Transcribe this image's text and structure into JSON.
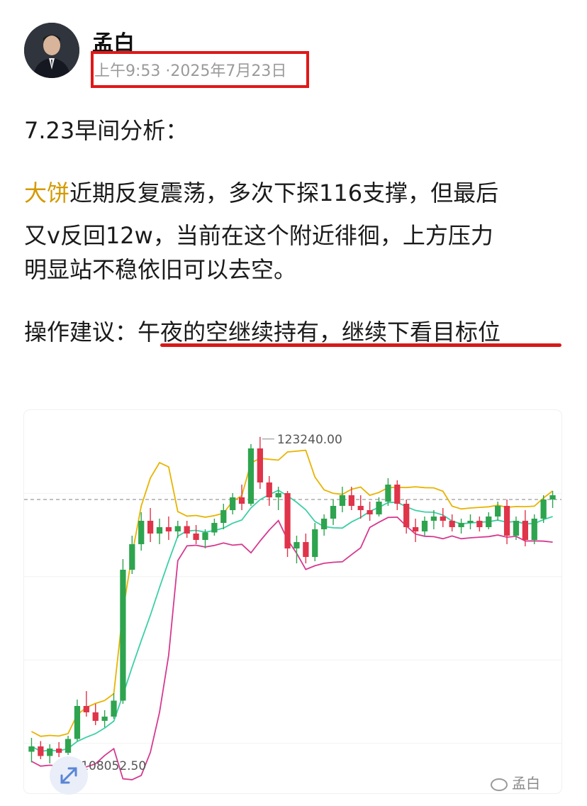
{
  "post": {
    "author": "孟白",
    "time": "上午9:53 ·2025年7月23日",
    "heading": "7.23早间分析：",
    "para_highlight": "大饼",
    "para_line1": "近期反复震荡，多次下探116支撑，但最后",
    "para_line2": "又v反回12w，当前在这个附近徘徊，上方压力",
    "para_line3": "明显站不稳依旧可以去空。",
    "advice_label": "操作建议：",
    "advice_text": "午夜的空继续持有，继续下看目标位"
  },
  "watermark": "孟白",
  "colors": {
    "highlight": "#d49a00",
    "timestamp_box": "#e01818",
    "underline": "#d71a1a",
    "candle_up": "#2ea44f",
    "candle_down": "#e0344a",
    "band_upper": "#e8b400",
    "band_middle": "#3ccfa6",
    "band_lower": "#d6398f"
  },
  "chart_data": {
    "type": "candlestick",
    "title": "",
    "price_labels": {
      "high": "123240.00",
      "low": "108052.50"
    },
    "ylim": [
      106500,
      124500
    ],
    "current_price_line": 120300,
    "bands": [
      "upper",
      "middle",
      "lower"
    ],
    "candles_ohlc": [
      [
        108450,
        109100,
        107950,
        108700
      ],
      [
        108700,
        108950,
        108100,
        108250
      ],
      [
        108250,
        108800,
        107900,
        108600
      ],
      [
        108600,
        108900,
        108200,
        108400
      ],
      [
        108400,
        109200,
        108300,
        109050
      ],
      [
        109050,
        110900,
        108950,
        110600
      ],
      [
        110600,
        111300,
        110100,
        110300
      ],
      [
        110300,
        110700,
        109700,
        109900
      ],
      [
        109900,
        110400,
        109600,
        110100
      ],
      [
        110100,
        111200,
        110000,
        110850
      ],
      [
        110850,
        117500,
        110700,
        117000
      ],
      [
        117000,
        118600,
        116800,
        118200
      ],
      [
        118200,
        119700,
        117900,
        119300
      ],
      [
        119300,
        119900,
        118300,
        118700
      ],
      [
        118700,
        119400,
        118200,
        119000
      ],
      [
        119000,
        119500,
        118400,
        118800
      ],
      [
        118800,
        119300,
        118500,
        119050
      ],
      [
        119050,
        119300,
        118500,
        118700
      ],
      [
        118700,
        119100,
        118200,
        118400
      ],
      [
        118400,
        118900,
        118000,
        118750
      ],
      [
        118750,
        119400,
        118600,
        119200
      ],
      [
        119200,
        120100,
        118900,
        119800
      ],
      [
        119800,
        120600,
        119600,
        120400
      ],
      [
        120400,
        121000,
        119800,
        120100
      ],
      [
        120100,
        122900,
        120000,
        122700
      ],
      [
        122700,
        123240,
        120800,
        121100
      ],
      [
        121100,
        121400,
        120000,
        120400
      ],
      [
        120400,
        120900,
        119800,
        120600
      ],
      [
        120600,
        120700,
        117600,
        118000
      ],
      [
        118000,
        118600,
        117300,
        118300
      ],
      [
        118300,
        118700,
        117300,
        117600
      ],
      [
        117600,
        119200,
        117400,
        118900
      ],
      [
        118900,
        119600,
        118600,
        119400
      ],
      [
        119400,
        120300,
        119100,
        120000
      ],
      [
        120000,
        120900,
        119700,
        120500
      ],
      [
        120500,
        120900,
        119800,
        120000
      ],
      [
        120000,
        120500,
        119400,
        119800
      ],
      [
        119800,
        120200,
        119300,
        119600
      ],
      [
        119600,
        120400,
        119500,
        120200
      ],
      [
        120200,
        121300,
        120000,
        121000
      ],
      [
        121000,
        121200,
        119800,
        120100
      ],
      [
        120100,
        120300,
        118700,
        119000
      ],
      [
        119000,
        119400,
        118300,
        118800
      ],
      [
        118800,
        119500,
        118600,
        119300
      ],
      [
        119300,
        119800,
        118900,
        119500
      ],
      [
        119500,
        119900,
        119000,
        119300
      ],
      [
        119300,
        119600,
        118800,
        119000
      ],
      [
        119000,
        119400,
        118700,
        119200
      ],
      [
        119200,
        119600,
        118900,
        119300
      ],
      [
        119300,
        119500,
        118800,
        119000
      ],
      [
        119000,
        119700,
        118900,
        119500
      ],
      [
        119500,
        120200,
        119300,
        120000
      ],
      [
        120000,
        120300,
        118200,
        118600
      ],
      [
        118600,
        119500,
        118400,
        119300
      ],
      [
        119300,
        119800,
        118100,
        118400
      ],
      [
        118400,
        119600,
        118200,
        119400
      ],
      [
        119400,
        120500,
        119200,
        120300
      ],
      [
        120300,
        120700,
        119900,
        120500
      ]
    ]
  }
}
